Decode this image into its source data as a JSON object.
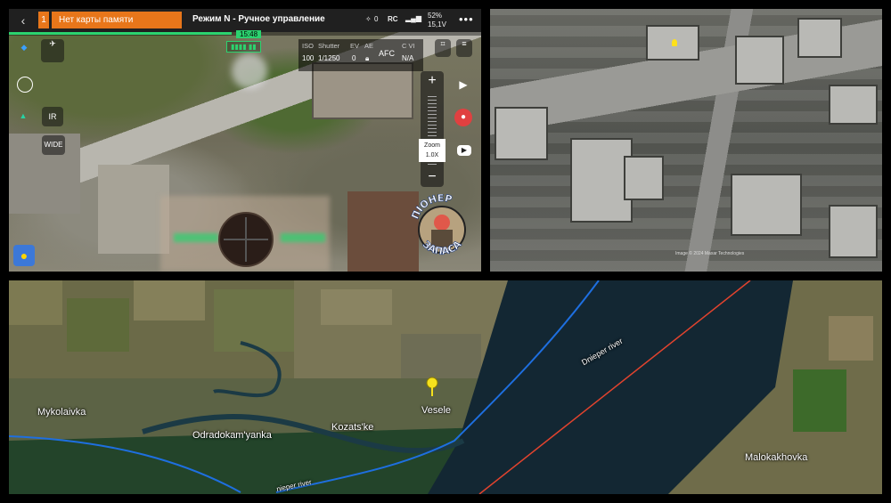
{
  "drone_view": {
    "back_symbol": "‹",
    "badge": "1",
    "warning": "Нет карты памяти",
    "mode": "Режим N - Ручное управление",
    "status": {
      "gps_count": "0",
      "rc_label": "RC",
      "battery_pct": "52%",
      "battery_voltage": "15,1V"
    },
    "menu_symbol": "•••",
    "time": "15:48",
    "camera": {
      "iso_label": "ISO",
      "iso_value": "100",
      "shutter_label": "Shutter",
      "shutter_value": "1/1250",
      "ev_label": "EV",
      "ev_value": "0",
      "ae_label": "AE",
      "afc_label": "AFC",
      "cvi_label": "C VI",
      "cvi_value": "N/A"
    },
    "ir_label": "IR",
    "wide_label": "WIDE",
    "zoom_label": "Zoom",
    "zoom_value": "1.0X",
    "zoom_plus": "+",
    "zoom_minus": "−",
    "emblem_text_top": "ПІОНЕР",
    "emblem_text_bottom": "ЗАПАСА"
  },
  "satellite_view": {
    "credit": "Image © 2024 Maxar Technologies"
  },
  "map": {
    "places": {
      "mykolaivka": "Mykolaivka",
      "odradokamyanka": "Odradokam'yanka",
      "kozatske": "Kozats'ke",
      "vesele": "Vesele",
      "malokakhovka": "Malokakhovka"
    },
    "river_label": "Dnieper river",
    "river_label_partial": "nieper river",
    "colors": {
      "blue_line": "#1e6fe0",
      "red_line": "#e2432e",
      "pin": "#f5e11d"
    }
  }
}
